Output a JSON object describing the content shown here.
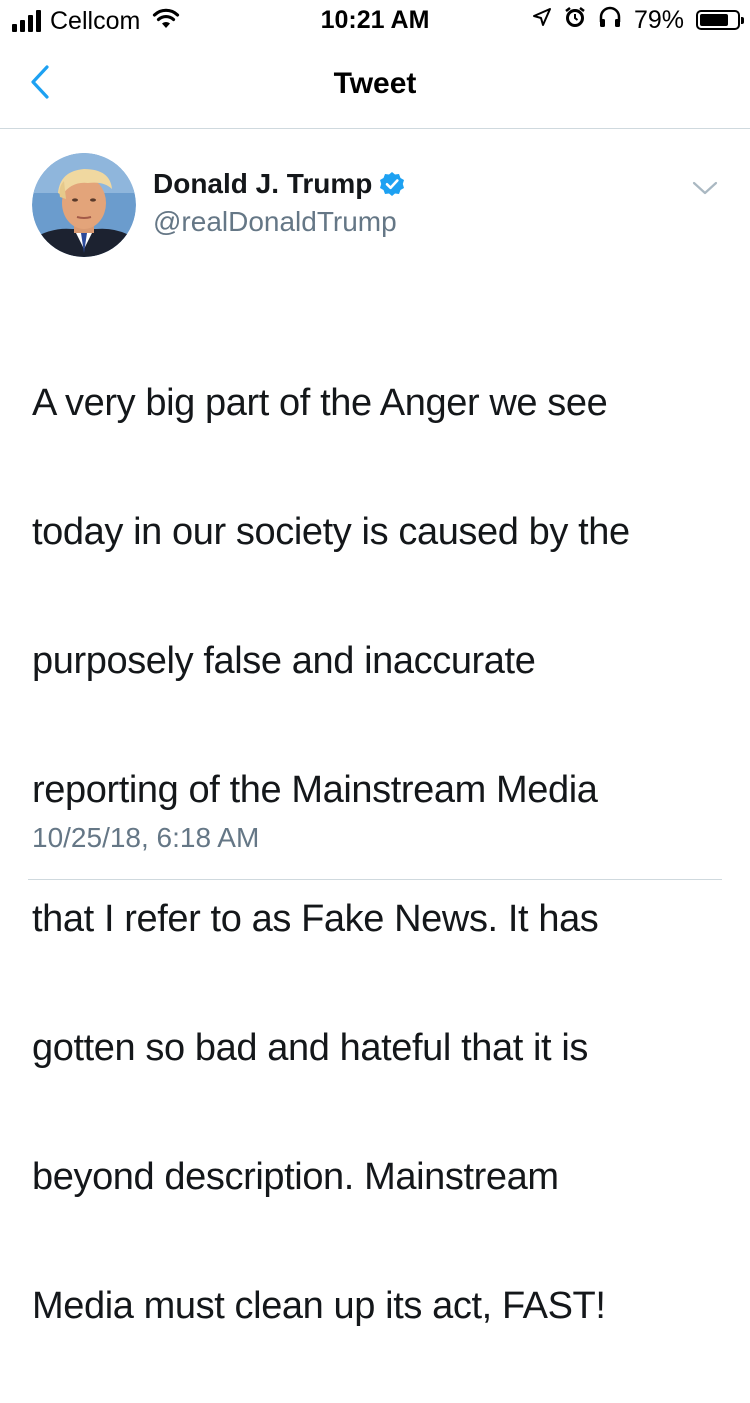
{
  "status_bar": {
    "carrier": "Cellcom",
    "time": "10:21 AM",
    "battery_percent": "79%",
    "battery_level": 0.79,
    "icons": [
      "signal-icon",
      "wifi-icon",
      "location-icon",
      "alarm-icon",
      "headphones-icon",
      "battery-icon"
    ]
  },
  "nav": {
    "title": "Tweet",
    "back_icon": "chevron-left-icon"
  },
  "tweet": {
    "author_name": "Donald J. Trump",
    "handle": "@realDonaldTrump",
    "verified": true,
    "text_lines": [
      "A very big part of the Anger we see",
      "today in our society is caused by the",
      "purposely false and inaccurate",
      "reporting of the Mainstream Media",
      "that I refer to as Fake News. It has",
      "gotten so bad and hateful that it is",
      "beyond description. Mainstream",
      "Media must clean up its act, FAST!"
    ],
    "timestamp": "10/25/18, 6:18 AM"
  },
  "colors": {
    "accent": "#1da1f2",
    "text_primary": "#14171a",
    "text_secondary": "#657786",
    "divider": "#cfd9de"
  }
}
